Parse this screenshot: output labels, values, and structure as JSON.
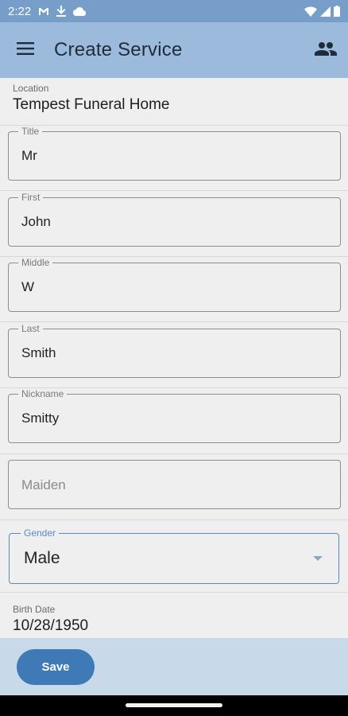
{
  "status_bar": {
    "time": "2:22",
    "icons": [
      "gmail-icon",
      "download-icon",
      "cloud-icon",
      "wifi-icon",
      "signal-icon",
      "battery-icon"
    ]
  },
  "app_bar": {
    "title": "Create Service",
    "menu_icon": "menu-icon",
    "action_icon": "people-icon"
  },
  "form": {
    "location": {
      "label": "Location",
      "value": "Tempest Funeral Home"
    },
    "title": {
      "label": "Title",
      "value": "Mr"
    },
    "first": {
      "label": "First",
      "value": "John"
    },
    "middle": {
      "label": "Middle",
      "value": "W"
    },
    "last": {
      "label": "Last",
      "value": "Smith"
    },
    "nickname": {
      "label": "Nickname",
      "value": "Smitty"
    },
    "maiden": {
      "placeholder": "Maiden",
      "value": ""
    },
    "gender": {
      "label": "Gender",
      "value": "Male"
    },
    "birth_date": {
      "label": "Birth Date",
      "value": "10/28/1950"
    }
  },
  "actions": {
    "save_label": "Save"
  },
  "colors": {
    "status_bar": "#779dc9",
    "app_bar": "#9cbbdc",
    "bottom_bar": "#c8daea",
    "accent": "#3f7ab7"
  }
}
